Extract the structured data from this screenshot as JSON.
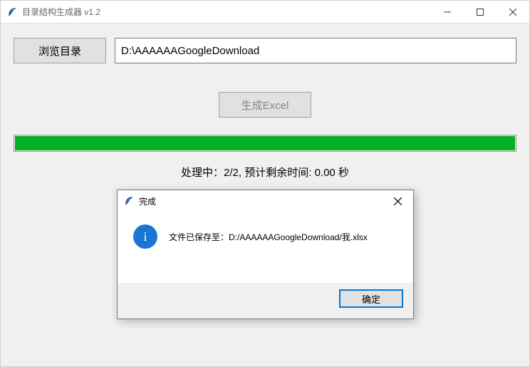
{
  "window": {
    "title": "目录结构生成器 v1.2"
  },
  "controls": {
    "browse_label": "浏览目录",
    "path_value": "D:\\AAAAAAGoogleDownload",
    "generate_label": "生成Excel"
  },
  "progress": {
    "percent": 100
  },
  "status": {
    "text": "处理中：2/2, 预计剩余时间: 0.00 秒"
  },
  "dialog": {
    "title": "完成",
    "message": "文件已保存至：D:/AAAAAAGoogleDownload/我.xlsx",
    "ok_label": "确定"
  }
}
